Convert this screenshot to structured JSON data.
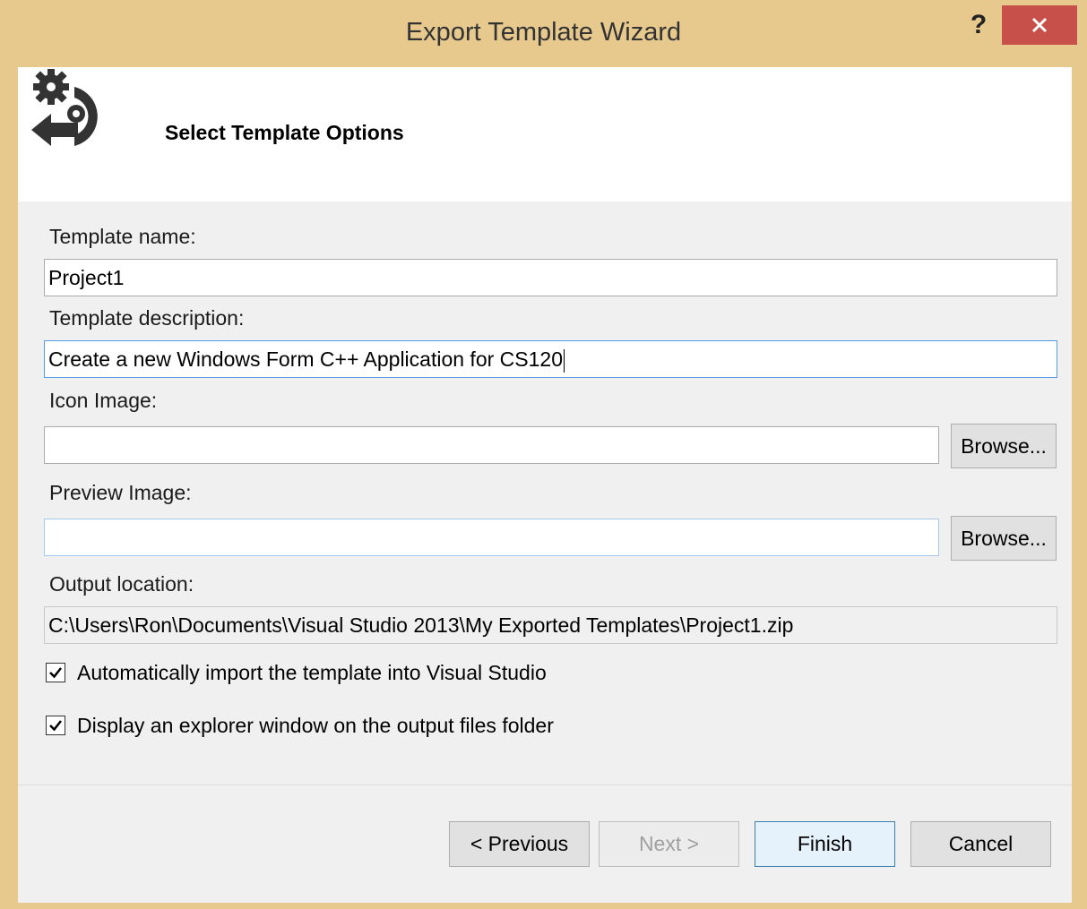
{
  "window": {
    "title": "Export Template Wizard",
    "help": "?",
    "close_icon": "close-icon"
  },
  "header": {
    "title": "Select Template Options",
    "icon": "gears-arrow-icon"
  },
  "form": {
    "template_name": {
      "label": "Template name:",
      "value": "Project1"
    },
    "template_description": {
      "label": "Template description:",
      "value": "Create a new Windows Form C++ Application for CS120"
    },
    "icon_image": {
      "label": "Icon Image:",
      "value": "",
      "browse": "Browse..."
    },
    "preview_image": {
      "label": "Preview Image:",
      "value": "",
      "browse": "Browse..."
    },
    "output_location": {
      "label": "Output location:",
      "value": "C:\\Users\\Ron\\Documents\\Visual Studio 2013\\My Exported Templates\\Project1.zip"
    },
    "auto_import": {
      "label": "Automatically import the template into Visual Studio",
      "checked": true
    },
    "display_explorer": {
      "label": "Display an explorer window on the output files folder",
      "checked": true
    }
  },
  "buttons": {
    "previous": "< Previous",
    "next": "Next >",
    "finish": "Finish",
    "cancel": "Cancel"
  },
  "colors": {
    "frame": "#e7c98e",
    "close": "#c7504b",
    "focus": "#569de5"
  }
}
